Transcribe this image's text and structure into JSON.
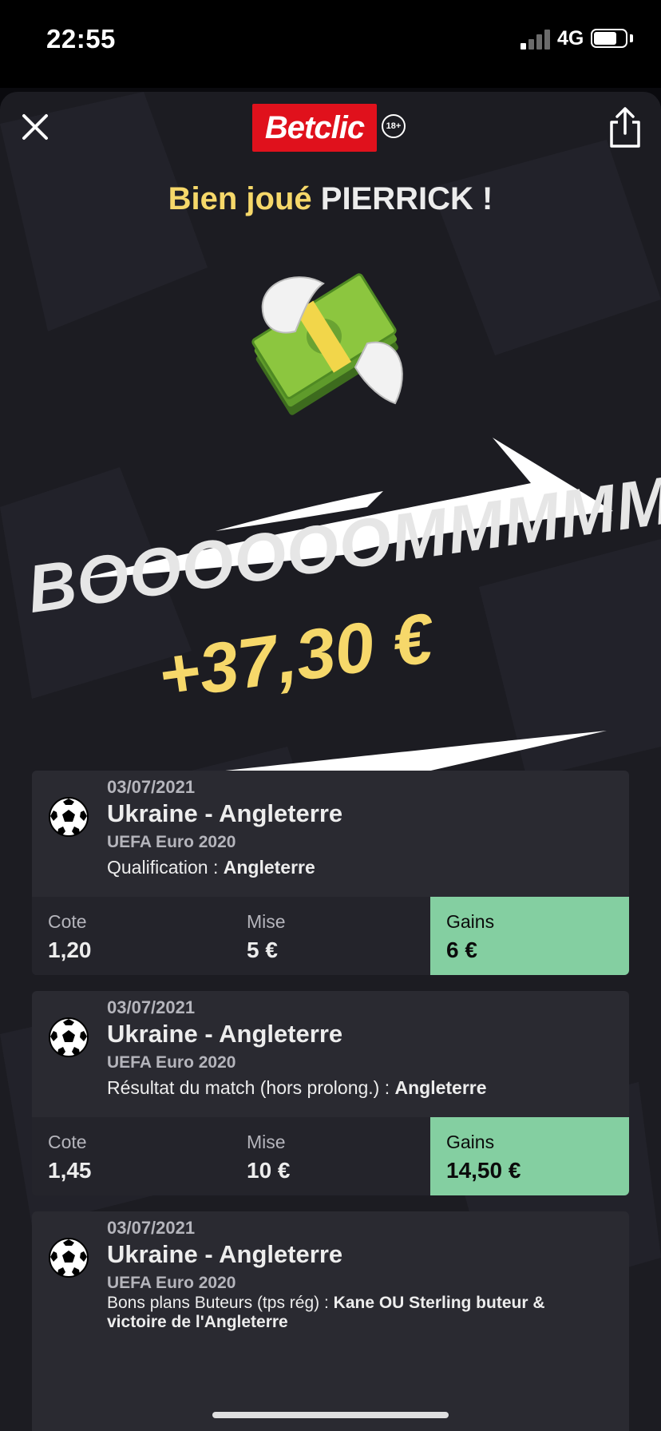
{
  "status_bar": {
    "time": "22:55",
    "network": "4G"
  },
  "header": {
    "logo": "Betclic",
    "age_badge": "18+",
    "close_icon": "close-icon",
    "share_icon": "share-icon"
  },
  "greeting": {
    "prefix": "Bien joué",
    "name": "PIERRICK !"
  },
  "celebration": {
    "title": "BOOOOOOMMMMM",
    "amount": "+37,30 €"
  },
  "colors": {
    "accent_yellow": "#f6d86a",
    "gains_green": "#84cfa1",
    "brand_red": "#e0111c",
    "card_bg": "#2a2a31"
  },
  "bets": [
    {
      "date": "03/07/2021",
      "match": "Ukraine - Angleterre",
      "competition": "UEFA Euro 2020",
      "market": "Qualification :",
      "selection": "Angleterre",
      "odds_label": "Cote",
      "odds": "1,20",
      "stake_label": "Mise",
      "stake": "5 €",
      "gains_label": "Gains",
      "gains": "6 €"
    },
    {
      "date": "03/07/2021",
      "match": "Ukraine - Angleterre",
      "competition": "UEFA Euro 2020",
      "market": "Résultat du match (hors prolong.) :",
      "selection": "Angleterre",
      "odds_label": "Cote",
      "odds": "1,45",
      "stake_label": "Mise",
      "stake": "10 €",
      "gains_label": "Gains",
      "gains": "14,50 €"
    },
    {
      "date": "03/07/2021",
      "match": "Ukraine - Angleterre",
      "competition": "UEFA Euro 2020",
      "market": "Bons plans Buteurs (tps rég) :",
      "selection": "Kane OU Sterling buteur & victoire de l'Angleterre"
    }
  ]
}
